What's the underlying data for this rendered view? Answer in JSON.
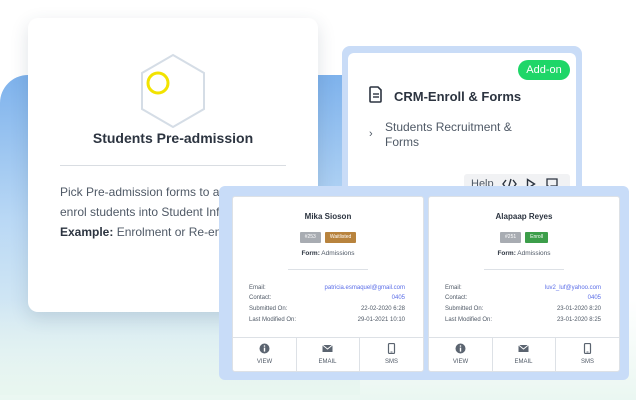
{
  "colors": {
    "accent_blue": "#7eb2ec",
    "addon_green": "#1ed668",
    "hexagon_yellow": "#f2e300",
    "waitlisted": "#b8833d",
    "enrolled": "#3c9e4a",
    "link": "#5b6ee8"
  },
  "preadmission": {
    "icon": "hexagon-icon",
    "title": "Students Pre-admission",
    "description": "Pick Pre-admission forms to accept and enrol students into Student Info System",
    "example_label": "Example:",
    "example_text": " Enrolment or Re-enrol forms"
  },
  "crm": {
    "badge": "Add-on",
    "icon": "document-icon",
    "title": "CRM-Enroll & Forms",
    "item_chevron": "›",
    "item": "Students Recruitment & Forms",
    "help_label": "Help",
    "toolbar_icons": [
      "code-icon",
      "play-icon",
      "comment-icon"
    ]
  },
  "submissions": [
    {
      "name": "Mika Sioson",
      "id": "#253",
      "status": "Waitlisted",
      "form_label": "Form:",
      "form_value": " Admissions",
      "rows": [
        {
          "label": "Email:",
          "value": "patricia.esmaquel@gmail.com"
        },
        {
          "label": "Contact:",
          "value": "0405"
        },
        {
          "label": "Submitted On:",
          "value": "22-02-2020 6:28"
        },
        {
          "label": "Last Modified On:",
          "value": "29-01-2021 10:10"
        }
      ],
      "actions": [
        "VIEW",
        "EMAIL",
        "SMS"
      ]
    },
    {
      "name": "Alapaap Reyes",
      "id": "#251",
      "status": "Enroll",
      "form_label": "Form:",
      "form_value": " Admissions",
      "rows": [
        {
          "label": "Email:",
          "value": "luv2_luf@yahoo.com"
        },
        {
          "label": "Contact:",
          "value": "0405"
        },
        {
          "label": "Submitted On:",
          "value": "23-01-2020 8:20"
        },
        {
          "label": "Last Modified On:",
          "value": "23-01-2020 8:25"
        }
      ],
      "actions": [
        "VIEW",
        "EMAIL",
        "SMS"
      ]
    }
  ]
}
